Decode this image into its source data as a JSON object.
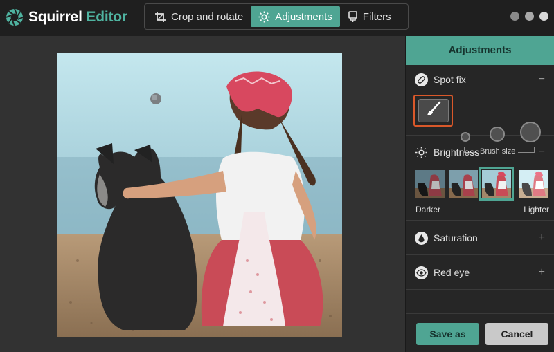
{
  "app": {
    "name_part1": "Squirrel",
    "name_part2": "Editor"
  },
  "toolbar": {
    "items": [
      {
        "label": "Crop and rotate",
        "icon": "crop-icon",
        "active": false
      },
      {
        "label": "Adjustments",
        "icon": "sun-icon",
        "active": true
      },
      {
        "label": "Filters",
        "icon": "filter-icon",
        "active": false
      }
    ]
  },
  "panel": {
    "title": "Adjustments",
    "sections": {
      "spot_fix": {
        "label": "Spot fix",
        "toggle": "−",
        "brush_size_label": "Brush size"
      },
      "brightness": {
        "label": "Brightness",
        "toggle": "−",
        "low_label": "Darker",
        "high_label": "Lighter"
      },
      "saturation": {
        "label": "Saturation",
        "toggle": "+"
      },
      "red_eye": {
        "label": "Red eye",
        "toggle": "+"
      }
    },
    "buttons": {
      "save": "Save as",
      "cancel": "Cancel"
    }
  },
  "colors": {
    "accent": "#4fa593",
    "brush_highlight": "#d9582a",
    "background": "#323232"
  }
}
